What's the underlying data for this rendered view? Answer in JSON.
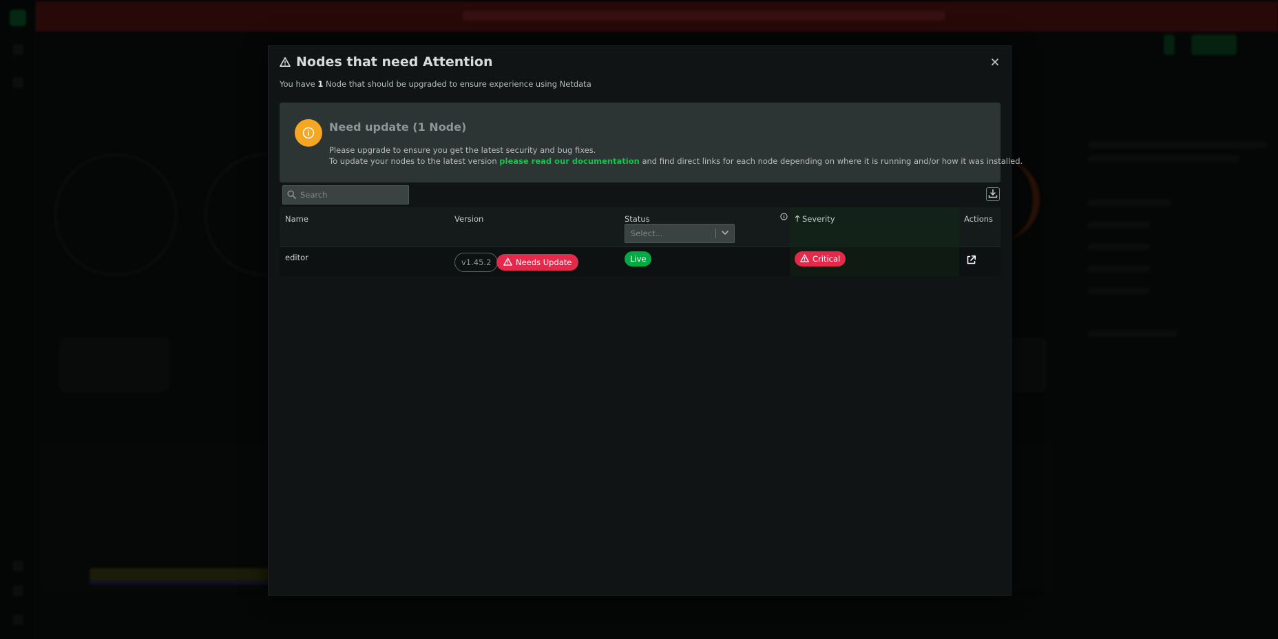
{
  "modal": {
    "title": "Nodes that need Attention",
    "subtitle_prefix": "You have ",
    "subtitle_count": "1",
    "subtitle_suffix": " Node that should be upgraded to ensure experience using Netdata",
    "close_icon": "close-icon"
  },
  "info_box": {
    "icon": "info-icon",
    "icon_color": "#f5a623",
    "heading": "Need update (1 Node)",
    "line1": "Please upgrade to ensure you get the latest security and bug fixes.",
    "line2_prefix": "To update your nodes to the latest version ",
    "line2_link": "please read our documentation",
    "line2_suffix": " and find direct links for each node depending on where it is running and/or how it was installed."
  },
  "search": {
    "placeholder": "Search"
  },
  "table": {
    "headers": {
      "name": "Name",
      "version": "Version",
      "status": "Status",
      "severity": "Severity",
      "severity_sort": "ascending",
      "actions": "Actions"
    },
    "status_filter_placeholder": "Select...",
    "rows": [
      {
        "name": "editor",
        "version": "v1.45.2",
        "version_badge": "Needs Update",
        "status": "Live",
        "severity": "Critical"
      }
    ]
  },
  "colors": {
    "accent_green": "#00ab44",
    "link_green": "#1bbf4f",
    "critical_red": "#e5294a",
    "warning_orange": "#f5a623"
  }
}
